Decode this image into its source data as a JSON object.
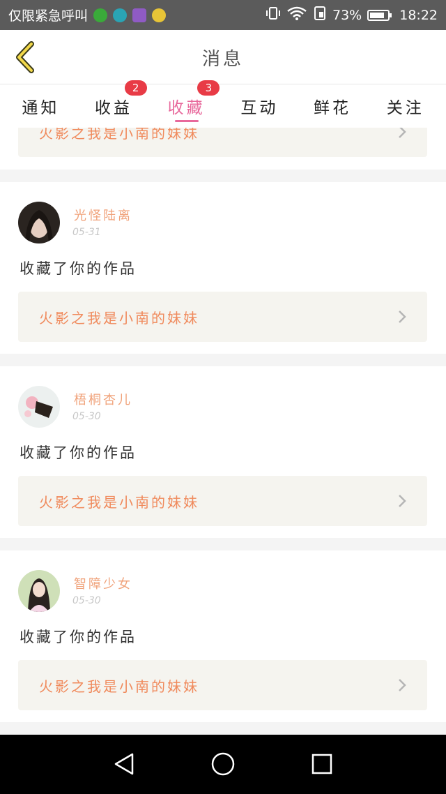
{
  "status_bar": {
    "carrier": "仅限紧急呼叫",
    "battery": "73%",
    "time": "18:22",
    "icons": [
      "green-app-icon",
      "moon-app-icon",
      "image-app-icon",
      "chat-app-icon",
      "vibrate-icon",
      "wifi-icon",
      "sim-icon",
      "battery-icon"
    ]
  },
  "header": {
    "title": "消息",
    "back_icon": "chevron-left-icon"
  },
  "tabs": [
    {
      "label": "通知",
      "badge": null,
      "active": false
    },
    {
      "label": "收益",
      "badge": "2",
      "active": false
    },
    {
      "label": "收藏",
      "badge": "3",
      "active": true
    },
    {
      "label": "互动",
      "badge": null,
      "active": false
    },
    {
      "label": "鲜花",
      "badge": null,
      "active": false
    },
    {
      "label": "关注",
      "badge": null,
      "active": false
    }
  ],
  "top_card": {
    "work_title": "火影之我是小南的妹妹"
  },
  "notifications": [
    {
      "username": "光怪陆离",
      "date": "05-31",
      "action": "收藏了你的作品",
      "work_title": "火影之我是小南的妹妹"
    },
    {
      "username": "梧桐杏儿",
      "date": "05-30",
      "action": "收藏了你的作品",
      "work_title": "火影之我是小南的妹妹"
    },
    {
      "username": "智障少女",
      "date": "05-30",
      "action": "收藏了你的作品",
      "work_title": "火影之我是小南的妹妹"
    }
  ],
  "colors": {
    "accent_pink": "#e8699c",
    "badge_red": "#e83b46",
    "work_title_orange": "#f08a5c",
    "username_orange": "#f0a27a"
  }
}
